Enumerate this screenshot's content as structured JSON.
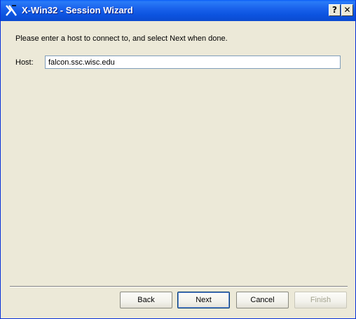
{
  "window": {
    "title": "X-Win32 - Session Wizard",
    "icon": "xwin32-logo-icon"
  },
  "titlebar_buttons": {
    "help_label": "?",
    "close_label": "✕"
  },
  "content": {
    "prompt": "Please enter a host to connect to, and select Next when done.",
    "host_label": "Host:",
    "host_value": "falcon.ssc.wisc.edu"
  },
  "buttons": {
    "back": "Back",
    "next": "Next",
    "cancel": "Cancel",
    "finish": "Finish"
  },
  "colors": {
    "titlebar": "#0c54e0",
    "background": "#ece9d8"
  }
}
